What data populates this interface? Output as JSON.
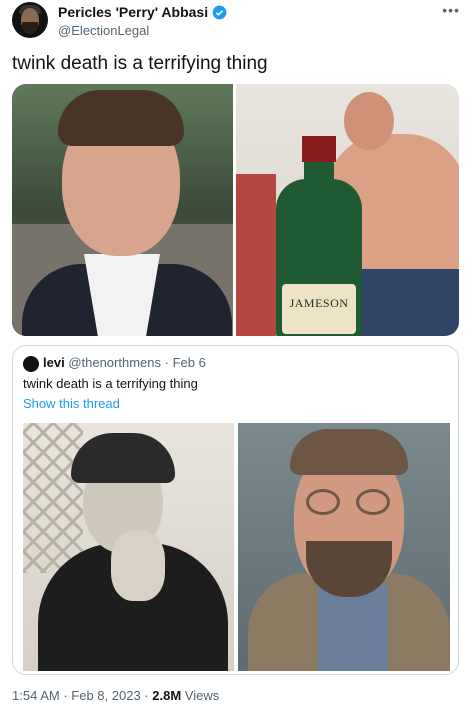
{
  "author": {
    "name": "Pericles 'Perry' Abbasi",
    "handle": "@ElectionLegal",
    "verified": true
  },
  "tweet": {
    "text": "twink death is a terrifying thing"
  },
  "media": {
    "image2_label": "JAMESON"
  },
  "quoted": {
    "name": "levi",
    "handle": "@thenorthmens",
    "date": "Feb 6",
    "text": "twink death is a terrifying thing",
    "show_thread": "Show this thread"
  },
  "footer": {
    "time": "1:54 AM",
    "date": "Feb 8, 2023",
    "views_count": "2.8M",
    "views_label": "Views"
  },
  "colors": {
    "verified": "#1d9bf0",
    "link": "#1d9bf0",
    "secondary_text": "#536471"
  }
}
